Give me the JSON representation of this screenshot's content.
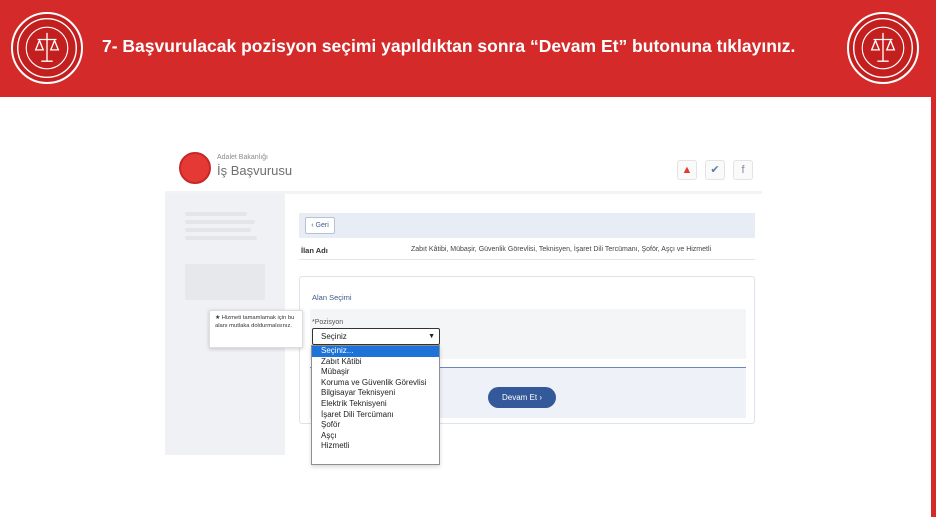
{
  "slide": {
    "title": "7- Başvurulacak pozisyon seçimi yapıldıktan sonra “Devam Et” butonuna tıklayınız.",
    "accent_color": "#d42a2a",
    "seal_icon": "ministry-seal-icon"
  },
  "app": {
    "org_name": "Adalet Bakanlığı",
    "app_name": "İş Başvurusu",
    "social": {
      "fire": "▲",
      "twitter": "✔",
      "facebook": "f"
    },
    "back_label": "‹ Geri",
    "ilan_label": "İlan Adı",
    "ilan_value": "Zabıt Kâtibi, Mübaşir, Güvenlik Görevlisi, Teknisyen, İşaret Dili Tercümanı, Şoför, Aşçı ve Hizmetli",
    "section_title": "Alan Seçimi",
    "field_label": "*Pozisyon",
    "select_value": "Seçiniz",
    "tooltip": "★ Hizmeti tamamlamak için bu alanı mutlaka doldurmalısınız.",
    "options": [
      "Seçiniz...",
      "Zabıt Kâtibi",
      "Mübaşir",
      "Koruma ve Güvenlik Görevlisi",
      "Bilgisayar Teknisyeni",
      "Elektrik Teknisyeni",
      "İşaret Dili Tercümanı",
      "Şoför",
      "Aşçı",
      "Hizmetli"
    ],
    "continue_label": "Devam Et ›",
    "primary_color": "#34599a",
    "highlight_color": "#1e73d8"
  }
}
